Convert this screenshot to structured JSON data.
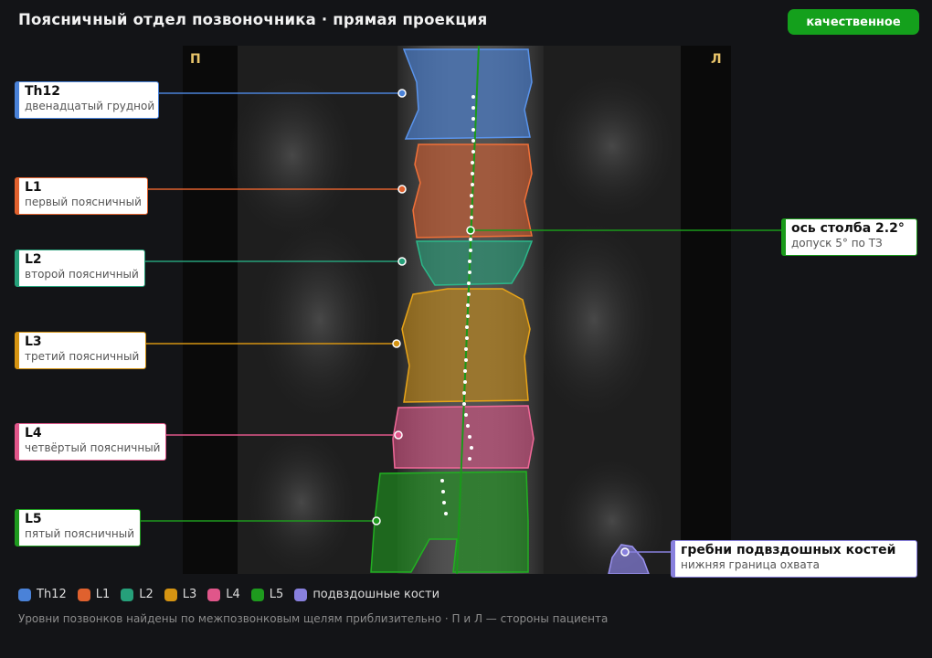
{
  "title": "Поясничный отдел позвоночника · прямая проекция",
  "quality_badge": "качественное",
  "orientation": {
    "right_marker": "П",
    "left_marker": "Л"
  },
  "vertebrae": [
    {
      "id": "Th12",
      "name": "Th12",
      "description": "двенадцатый грудной",
      "color": "#4a82d8"
    },
    {
      "id": "L1",
      "name": "L1",
      "description": "первый поясничный",
      "color": "#e0612e"
    },
    {
      "id": "L2",
      "name": "L2",
      "description": "второй поясничный",
      "color": "#26a07a"
    },
    {
      "id": "L3",
      "name": "L3",
      "description": "третий поясничный",
      "color": "#d59412"
    },
    {
      "id": "L4",
      "name": "L4",
      "description": "четвёртый поясничный",
      "color": "#e0568a"
    },
    {
      "id": "L5",
      "name": "L5",
      "description": "пятый поясничный",
      "color": "#1e9a1e"
    }
  ],
  "axis": {
    "name": "ось столба 2.2°",
    "description": "допуск 5° по ТЗ",
    "angle_deg": 2.2,
    "tolerance_deg": 5,
    "color": "#1a9a1a"
  },
  "iliac": {
    "name": "гребни подвздошных костей",
    "description": "нижняя граница охвата",
    "color": "#8880de"
  },
  "legend": [
    {
      "label": "Th12",
      "color": "#4a82d8"
    },
    {
      "label": "L1",
      "color": "#e0612e"
    },
    {
      "label": "L2",
      "color": "#26a07a"
    },
    {
      "label": "L3",
      "color": "#d59412"
    },
    {
      "label": "L4",
      "color": "#e0568a"
    },
    {
      "label": "L5",
      "color": "#1e9a1e"
    },
    {
      "label": "подвздошные кости",
      "color": "#8880de"
    }
  ],
  "footnote": "Уровни позвонков найдены по межпозвонковым щелям приблизительно · П и Л — стороны пациента"
}
